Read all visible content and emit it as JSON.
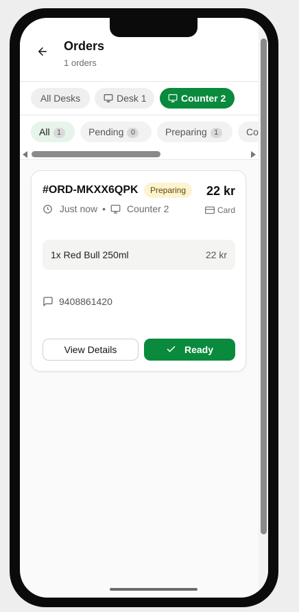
{
  "header": {
    "title": "Orders",
    "subtitle": "1 orders",
    "back_icon": "arrow-left-icon"
  },
  "desks": [
    {
      "label": "All Desks",
      "icon": null,
      "active": false
    },
    {
      "label": "Desk 1",
      "icon": "monitor-icon",
      "active": false
    },
    {
      "label": "Counter 2",
      "icon": "monitor-icon",
      "active": true
    }
  ],
  "status_tabs": [
    {
      "label": "All",
      "count": "1",
      "active": true
    },
    {
      "label": "Pending",
      "count": "0",
      "active": false
    },
    {
      "label": "Preparing",
      "count": "1",
      "active": false
    },
    {
      "label": "Co",
      "count": "",
      "active": false
    }
  ],
  "order": {
    "id": "#ORD-MKXX6QPK",
    "status": "Preparing",
    "total": "22 kr",
    "time": "Just now",
    "separator": "•",
    "desk": "Counter 2",
    "payment": "Card",
    "items": [
      {
        "label": "1x Red Bull 250ml",
        "price": "22 kr"
      }
    ],
    "phone": "9408861420",
    "view_details_label": "View Details",
    "ready_label": "Ready"
  },
  "colors": {
    "accent": "#0a8a3c",
    "status_preparing_bg": "#fdf3cf",
    "active_tab_bg": "#e6f4ea"
  }
}
